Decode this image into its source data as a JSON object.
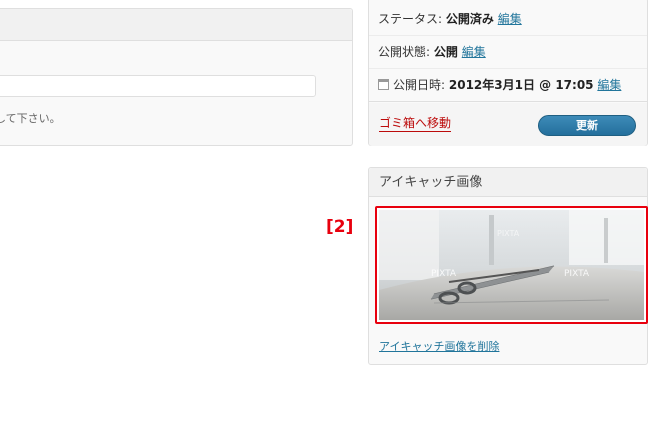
{
  "editor": {
    "hint_text": "記述して下さい。"
  },
  "publish": {
    "status_label": "ステータス:",
    "status_value": "公開済み",
    "status_edit": "編集",
    "visibility_label": "公開状態:",
    "visibility_value": "公開",
    "visibility_edit": "編集",
    "date_label": "公開日時:",
    "date_value": "2012年3月1日 @ 17:05",
    "date_edit": "編集",
    "trash_label": "ゴミ箱へ移動",
    "update_label": "更新"
  },
  "featured_image": {
    "title": "アイキャッチ画像",
    "remove_label": "アイキャッチ画像を削除",
    "watermark": "PIXTA"
  },
  "annotation": {
    "label": "[2]"
  },
  "colors": {
    "link": "#21759b",
    "trash": "#bc0b0b",
    "highlight": "#e8000e",
    "button": "#2b7bab"
  }
}
